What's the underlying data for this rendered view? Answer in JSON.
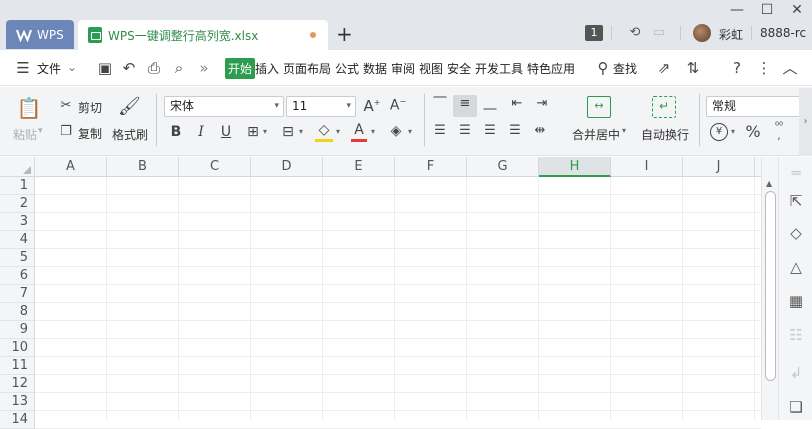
{
  "titlebar": {
    "home_tab": "WPS",
    "doc_tab": "WPS一键调整行高列宽.xlsx",
    "badge": "1",
    "user_name": "彩虹",
    "user_id": "8888-rc"
  },
  "menubar": {
    "file": "文件",
    "tabs": [
      "开始",
      "插入",
      "页面布局",
      "公式",
      "数据",
      "审阅",
      "视图",
      "安全",
      "开发工具",
      "特色应用"
    ],
    "search": "查找"
  },
  "ribbon": {
    "paste": "粘贴",
    "cut": "剪切",
    "copy": "复制",
    "format_painter": "格式刷",
    "font_name": "宋体",
    "font_size": "11",
    "merge_center": "合并居中",
    "wrap_text": "自动换行",
    "number_format": "常规"
  },
  "grid": {
    "columns": [
      "A",
      "B",
      "C",
      "D",
      "E",
      "F",
      "G",
      "H",
      "I",
      "J"
    ],
    "selected_column": "H",
    "rows": [
      "1",
      "2",
      "3",
      "4",
      "5",
      "6",
      "7",
      "8",
      "9",
      "10",
      "11",
      "12",
      "13",
      "14"
    ]
  },
  "colors": {
    "accent": "#2e9c4e",
    "home_tab": "#6d86b8"
  }
}
